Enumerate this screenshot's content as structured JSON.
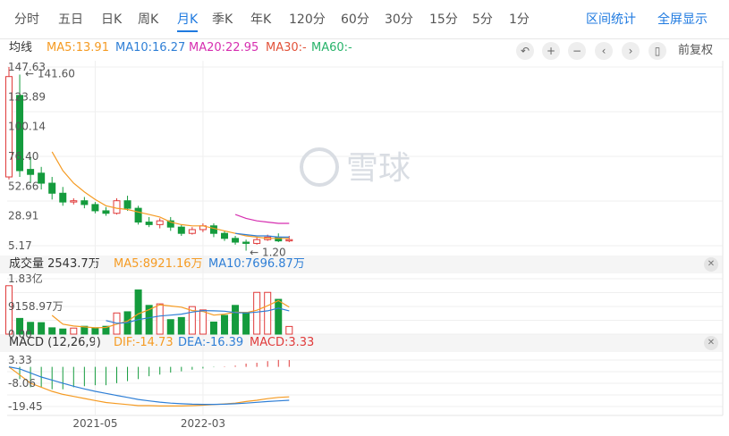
{
  "tabs": [
    "分时",
    "五日",
    "日K",
    "周K",
    "月K",
    "季K",
    "年K",
    "120分",
    "60分",
    "30分",
    "15分",
    "5分",
    "1分"
  ],
  "active_tab": "月K",
  "right_actions": [
    "区间统计",
    "全屏显示"
  ],
  "ma_legend": {
    "title": "均线",
    "ma5": "MA5:13.91",
    "ma10": "MA10:16.27",
    "ma20": "MA20:22.95",
    "ma30": "MA30:-",
    "ma60": "MA60:-"
  },
  "controls": {
    "icons": [
      "undo-icon",
      "zoom-in-icon",
      "zoom-out-icon",
      "prev-icon",
      "next-icon",
      "candle-icon"
    ],
    "fuquan_label": "前复权"
  },
  "watermark": "雪球",
  "price_axis": {
    "ticks": [
      "147.63",
      "123.89",
      "100.14",
      "76.40",
      "52.66",
      "28.91",
      "5.17"
    ],
    "high_label": "141.60",
    "low_label": "1.20"
  },
  "volume_legend": {
    "title": "成交量 2543.7万",
    "ma5": "MA5:8921.16万",
    "ma10": "MA10:7696.87万"
  },
  "volume_axis": {
    "ticks": [
      "1.83亿",
      "9158.97万",
      "0.00"
    ]
  },
  "macd_legend": {
    "title": "MACD (12,26,9)",
    "dif": "DIF:-14.73",
    "dea": "DEA:-16.39",
    "macd": "MACD:3.33"
  },
  "macd_axis": {
    "ticks": [
      "3.33",
      "-8.06",
      "-19.45"
    ]
  },
  "date_axis": [
    "2021-05",
    "2022-03"
  ],
  "colors": {
    "up": "#e03a3a",
    "down": "#149b3d",
    "ma5": "#f59b23",
    "ma10": "#2f7fd6",
    "ma20": "#d62fb0",
    "ma30": "#e2533a",
    "ma60": "#27b36a",
    "accent": "#1f7ae0"
  },
  "chart_data": {
    "type": "candlestick",
    "price_range": [
      5.17,
      147.63
    ],
    "candles": [
      {
        "o": 60,
        "c": 140,
        "h": 147.63,
        "l": 58
      },
      {
        "o": 125,
        "c": 65,
        "h": 141.6,
        "l": 60
      },
      {
        "o": 66,
        "c": 62,
        "h": 76,
        "l": 55
      },
      {
        "o": 63,
        "c": 55,
        "h": 68,
        "l": 50
      },
      {
        "o": 55,
        "c": 47,
        "h": 60,
        "l": 42
      },
      {
        "o": 47,
        "c": 40,
        "h": 52,
        "l": 37
      },
      {
        "o": 40,
        "c": 41,
        "h": 43,
        "l": 38
      },
      {
        "o": 41,
        "c": 38,
        "h": 44,
        "l": 35
      },
      {
        "o": 38,
        "c": 33,
        "h": 40,
        "l": 31
      },
      {
        "o": 33,
        "c": 31,
        "h": 36,
        "l": 29
      },
      {
        "o": 31,
        "c": 41,
        "h": 43,
        "l": 30
      },
      {
        "o": 41,
        "c": 35,
        "h": 45,
        "l": 33
      },
      {
        "o": 35,
        "c": 24,
        "h": 37,
        "l": 22
      },
      {
        "o": 24,
        "c": 22,
        "h": 28,
        "l": 20
      },
      {
        "o": 22,
        "c": 25,
        "h": 27,
        "l": 19
      },
      {
        "o": 25,
        "c": 20,
        "h": 28,
        "l": 17
      },
      {
        "o": 20,
        "c": 15,
        "h": 22,
        "l": 13
      },
      {
        "o": 15,
        "c": 18,
        "h": 20,
        "l": 14
      },
      {
        "o": 18,
        "c": 21,
        "h": 23,
        "l": 16
      },
      {
        "o": 21,
        "c": 15,
        "h": 23,
        "l": 12
      },
      {
        "o": 15,
        "c": 11,
        "h": 17,
        "l": 9
      },
      {
        "o": 11,
        "c": 8,
        "h": 13,
        "l": 6
      },
      {
        "o": 8,
        "c": 7,
        "h": 10,
        "l": 1.2
      },
      {
        "o": 7,
        "c": 10,
        "h": 12,
        "l": 6
      },
      {
        "o": 10,
        "c": 12,
        "h": 14,
        "l": 9
      },
      {
        "o": 12,
        "c": 9,
        "h": 15,
        "l": 8
      },
      {
        "o": 9,
        "c": 10,
        "h": 13,
        "l": 8
      }
    ],
    "ma5": [
      null,
      null,
      null,
      null,
      80,
      65,
      55,
      48,
      42,
      37,
      35,
      34,
      32,
      30,
      28,
      24,
      22,
      21,
      21,
      19,
      17,
      15,
      13,
      12,
      11,
      11,
      11
    ],
    "ma10": [
      null,
      null,
      null,
      null,
      null,
      null,
      null,
      null,
      null,
      null,
      null,
      null,
      null,
      null,
      null,
      null,
      null,
      null,
      null,
      null,
      null,
      15,
      14,
      13,
      13,
      12,
      12
    ],
    "ma20": [
      null,
      null,
      null,
      null,
      null,
      null,
      null,
      null,
      null,
      null,
      null,
      null,
      null,
      null,
      null,
      null,
      null,
      null,
      null,
      null,
      null,
      30,
      27,
      25,
      24,
      23,
      23
    ],
    "volume_range": [
      0,
      18300
    ],
    "volume": [
      16000,
      5200,
      3900,
      3800,
      2100,
      1700,
      2000,
      2600,
      2100,
      2600,
      7000,
      7400,
      14600,
      9500,
      10000,
      4800,
      5500,
      9100,
      8000,
      4000,
      6200,
      9500,
      7200,
      13800,
      13800,
      11500,
      2544
    ],
    "volume_ma5": [
      null,
      null,
      null,
      null,
      6200,
      3300,
      2700,
      2400,
      2100,
      2200,
      3300,
      4300,
      6700,
      8100,
      9700,
      9300,
      8900,
      7800,
      7500,
      6300,
      6600,
      7300,
      7100,
      7900,
      9400,
      11100,
      8921
    ],
    "volume_ma10": [
      null,
      null,
      null,
      null,
      null,
      null,
      null,
      null,
      null,
      4500,
      3600,
      3800,
      4800,
      5400,
      6000,
      6300,
      6600,
      7300,
      7800,
      7700,
      7600,
      7100,
      7000,
      7300,
      7700,
      8600,
      7697
    ],
    "macd_range": [
      -19.45,
      3.33
    ],
    "dif": [
      0,
      -4,
      -8,
      -10,
      -12,
      -13.5,
      -14.5,
      -15.5,
      -16.5,
      -17.5,
      -18,
      -18.5,
      -19,
      -19,
      -19.2,
      -19.2,
      -19.2,
      -19,
      -18.8,
      -18.5,
      -18.2,
      -17.8,
      -17,
      -16.4,
      -15.6,
      -15,
      -14.73
    ],
    "dea": [
      0,
      -1,
      -3,
      -5,
      -6.5,
      -8,
      -9.5,
      -10.8,
      -12,
      -13,
      -14,
      -15,
      -16,
      -16.7,
      -17.3,
      -17.8,
      -18.1,
      -18.3,
      -18.4,
      -18.4,
      -18.3,
      -18.1,
      -17.8,
      -17.4,
      -17,
      -16.7,
      -16.39
    ],
    "macd": [
      0,
      -6,
      -10,
      -10,
      -11,
      -11,
      -10,
      -9.5,
      -9,
      -9,
      -8,
      -7,
      -6,
      -4.6,
      -3.8,
      -2.8,
      -2.2,
      -1.4,
      -0.8,
      -0.2,
      0.2,
      0.6,
      1.6,
      2,
      2.8,
      3.4,
      3.33
    ],
    "date_ticks": [
      {
        "label": "2021-05",
        "index": 8
      },
      {
        "label": "2022-03",
        "index": 18
      }
    ]
  }
}
